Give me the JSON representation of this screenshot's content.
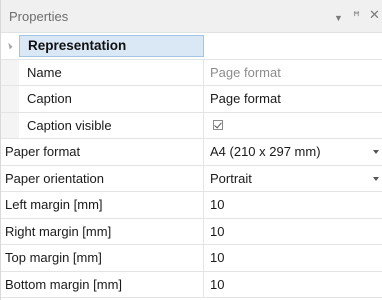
{
  "panel": {
    "title": "Properties",
    "icons": {
      "dropdown": "triangle-down-icon",
      "pin": "pin-icon",
      "close": "close-icon"
    }
  },
  "category": {
    "label": "Representation"
  },
  "properties": [
    {
      "name": "Name",
      "value": "Page format"
    },
    {
      "name": "Caption",
      "value": "Page format"
    },
    {
      "name": "Caption visible",
      "value": true
    },
    {
      "name": "Paper format",
      "value": "A4 (210 x 297 mm)"
    },
    {
      "name": "Paper orientation",
      "value": "Portrait"
    },
    {
      "name": "Left margin [mm]",
      "value": "10"
    },
    {
      "name": "Right margin [mm]",
      "value": "10"
    },
    {
      "name": "Top margin [mm]",
      "value": "10"
    },
    {
      "name": "Bottom margin [mm]",
      "value": "10"
    }
  ]
}
